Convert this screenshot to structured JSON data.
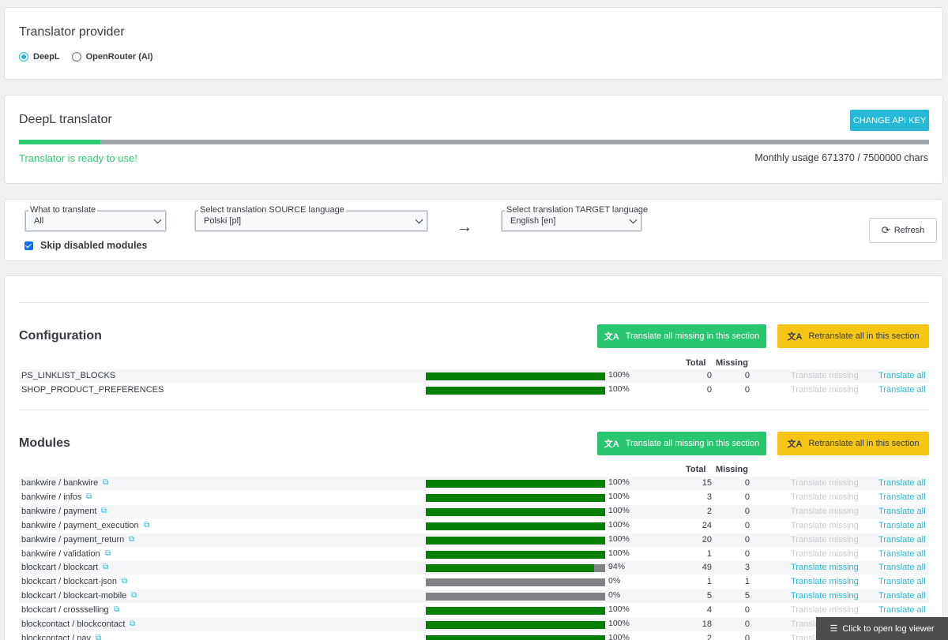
{
  "provider": {
    "title": "Translator provider",
    "options": [
      {
        "label": "DeepL",
        "selected": true
      },
      {
        "label": "OpenRouter (AI)",
        "selected": false
      }
    ]
  },
  "deepl": {
    "title": "DeepL translator",
    "change_api_key_label": "CHANGE API KEY",
    "status_text": "Translator is ready to use!",
    "usage_text": "Monthly usage 671370 / 7500000 chars",
    "usage_fraction": 0.0895
  },
  "filters": {
    "what_label": "What to translate",
    "what_value": "All",
    "source_label": "Select translation SOURCE language",
    "source_value": "Polski [pl]",
    "target_label": "Select translation TARGET language",
    "target_value": "English [en]",
    "skip_disabled_label": "Skip disabled modules",
    "skip_disabled_checked": true,
    "refresh_label": "Refresh"
  },
  "labels": {
    "translate_all_missing": "Translate all missing in this section",
    "retranslate_all": "Retranslate all in this section",
    "total": "Total",
    "missing": "Missing",
    "translate_missing": "Translate missing",
    "translate_all": "Translate all"
  },
  "sections": [
    {
      "title": "Configuration",
      "rows": [
        {
          "name": "PS_LINKLIST_BLOCKS",
          "pct": "100%",
          "fraction": 1.0,
          "total": "0",
          "missing": "0",
          "link": false
        },
        {
          "name": "SHOP_PRODUCT_PREFERENCES",
          "pct": "100%",
          "fraction": 1.0,
          "total": "0",
          "missing": "0",
          "link": false
        }
      ]
    },
    {
      "title": "Modules",
      "rows": [
        {
          "name": "bankwire / bankwire",
          "pct": "100%",
          "fraction": 1.0,
          "total": "15",
          "missing": "0",
          "link": true
        },
        {
          "name": "bankwire / infos",
          "pct": "100%",
          "fraction": 1.0,
          "total": "3",
          "missing": "0",
          "link": true
        },
        {
          "name": "bankwire / payment",
          "pct": "100%",
          "fraction": 1.0,
          "total": "2",
          "missing": "0",
          "link": true
        },
        {
          "name": "bankwire / payment_execution",
          "pct": "100%",
          "fraction": 1.0,
          "total": "24",
          "missing": "0",
          "link": true
        },
        {
          "name": "bankwire / payment_return",
          "pct": "100%",
          "fraction": 1.0,
          "total": "20",
          "missing": "0",
          "link": true
        },
        {
          "name": "bankwire / validation",
          "pct": "100%",
          "fraction": 1.0,
          "total": "1",
          "missing": "0",
          "link": true
        },
        {
          "name": "blockcart / blockcart",
          "pct": "94%",
          "fraction": 0.94,
          "total": "49",
          "missing": "3",
          "link": true
        },
        {
          "name": "blockcart / blockcart-json",
          "pct": "0%",
          "fraction": 0.0,
          "total": "1",
          "missing": "1",
          "link": true
        },
        {
          "name": "blockcart / blockcart-mobile",
          "pct": "0%",
          "fraction": 0.0,
          "total": "5",
          "missing": "5",
          "link": true
        },
        {
          "name": "blockcart / crossselling",
          "pct": "100%",
          "fraction": 1.0,
          "total": "4",
          "missing": "0",
          "link": true
        },
        {
          "name": "blockcontact / blockcontact",
          "pct": "100%",
          "fraction": 1.0,
          "total": "18",
          "missing": "0",
          "link": true
        },
        {
          "name": "blockcontact / nav",
          "pct": "100%",
          "fraction": 1.0,
          "total": "2",
          "missing": "0",
          "link": true
        }
      ]
    }
  ],
  "log_viewer_label": "Click to open log viewer"
}
